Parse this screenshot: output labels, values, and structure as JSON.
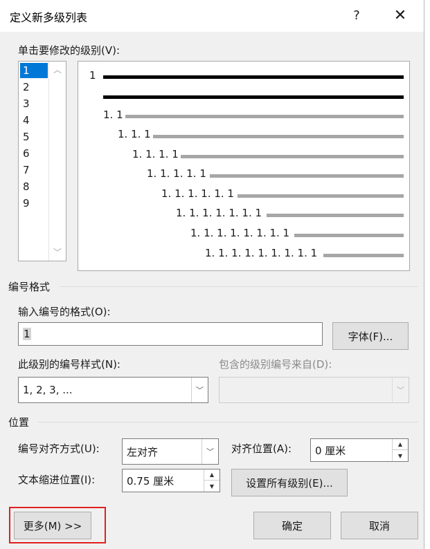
{
  "dialog": {
    "title": "定义新多级列表",
    "help": "?",
    "close": "✕"
  },
  "levels": {
    "label": "单击要修改的级别(V):",
    "items": [
      "1",
      "2",
      "3",
      "4",
      "5",
      "6",
      "7",
      "8",
      "9"
    ],
    "selected": "1"
  },
  "preview": {
    "labels": [
      "1",
      "1. 1",
      "1. 1. 1",
      "1. 1. 1. 1",
      "1. 1. 1. 1. 1",
      "1. 1. 1. 1. 1. 1",
      "1. 1. 1. 1. 1. 1. 1",
      "1. 1. 1. 1. 1. 1. 1. 1",
      "1. 1. 1. 1. 1. 1. 1. 1. 1"
    ]
  },
  "number_format": {
    "group_label": "编号格式",
    "format_label": "输入编号的格式(O):",
    "format_value": "1",
    "font_button": "字体(F)...",
    "style_label": "此级别的编号样式(N):",
    "style_value": "1, 2, 3, ...",
    "include_label": "包含的级别编号来自(D):",
    "include_value": ""
  },
  "position": {
    "group_label": "位置",
    "align_label": "编号对齐方式(U):",
    "align_value": "左对齐",
    "align_at_label": "对齐位置(A):",
    "align_at_value": "0 厘米",
    "indent_label": "文本缩进位置(I):",
    "indent_value": "0.75 厘米",
    "set_all_button": "设置所有级别(E)..."
  },
  "footer": {
    "more_button": "更多(M) >>",
    "ok_button": "确定",
    "cancel_button": "取消"
  },
  "colors": {
    "selection": "#0078d7",
    "highlight": "#e02020",
    "preview_dark": "#000000",
    "preview_gray": "#a6a6a6"
  }
}
